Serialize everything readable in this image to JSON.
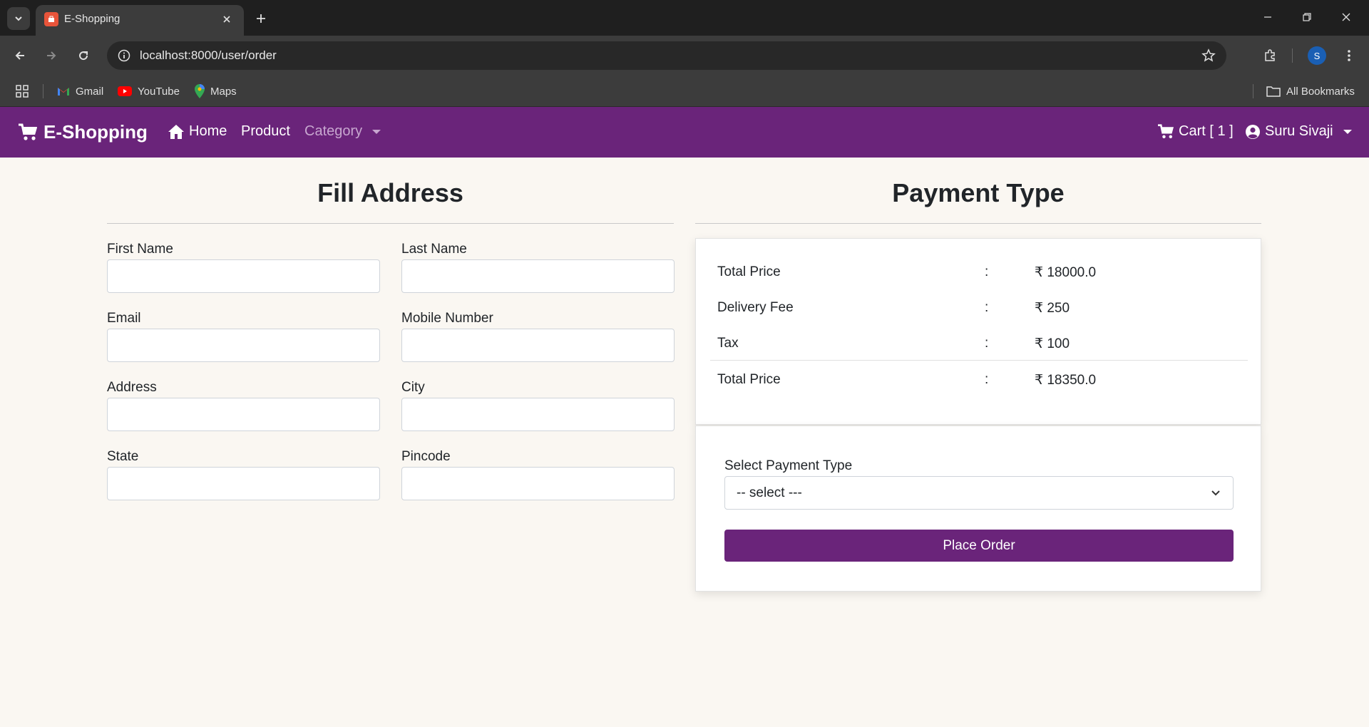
{
  "browser": {
    "tab_title": "E-Shopping",
    "url": "localhost:8000/user/order",
    "profile_initial": "S",
    "bookmarks": [
      {
        "label": "Gmail",
        "icon": "gmail-icon"
      },
      {
        "label": "YouTube",
        "icon": "youtube-icon"
      },
      {
        "label": "Maps",
        "icon": "maps-icon"
      }
    ],
    "all_bookmarks_label": "All Bookmarks"
  },
  "navbar": {
    "brand": "E-Shopping",
    "home": "Home",
    "product": "Product",
    "category": "Category",
    "cart": "Cart [ 1 ]",
    "user": "Suru Sivaji",
    "accent_color": "#6a247a"
  },
  "address": {
    "title": "Fill Address",
    "fields": {
      "first_name": "First Name",
      "last_name": "Last Name",
      "email": "Email",
      "mobile": "Mobile Number",
      "address": "Address",
      "city": "City",
      "state": "State",
      "pincode": "Pincode"
    }
  },
  "payment": {
    "title": "Payment Type",
    "summary": [
      {
        "label": "Total Price",
        "sep": ":",
        "value": "₹ 18000.0"
      },
      {
        "label": "Delivery Fee",
        "sep": ":",
        "value": "₹ 250"
      },
      {
        "label": "Tax",
        "sep": ":",
        "value": "₹ 100"
      },
      {
        "label": "Total Price",
        "sep": ":",
        "value": "₹ 18350.0"
      }
    ],
    "select_label": "Select Payment Type",
    "select_value": "-- select ---",
    "place_order": "Place Order"
  }
}
